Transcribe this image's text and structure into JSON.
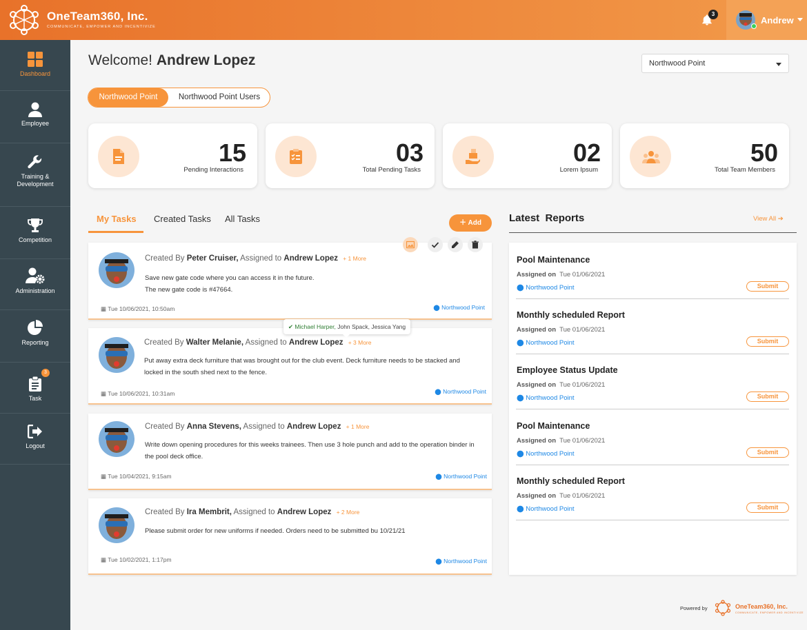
{
  "header": {
    "brand_name": "OneTeam360, Inc.",
    "brand_tagline": "COMMUNICATE, EMPOWER AND INCENTIVIZE",
    "notification_count": "3",
    "user_name": "Andrew",
    "colors": {
      "accent": "#f7943b",
      "sidebar": "#37474f",
      "link": "#1e88e5"
    }
  },
  "sidebar": {
    "items": [
      {
        "label": "Dashboard",
        "icon": "dashboard-grid-icon"
      },
      {
        "label": "Employee",
        "icon": "employee-icon"
      },
      {
        "label": "Training &\nDevelopment",
        "icon": "wrench-icon"
      },
      {
        "label": "Competition",
        "icon": "trophy-icon"
      },
      {
        "label": "Administration",
        "icon": "admin-gear-icon"
      },
      {
        "label": "Reporting",
        "icon": "pie-chart-icon"
      },
      {
        "label": "Task",
        "icon": "clipboard-icon",
        "badge": "3"
      },
      {
        "label": "Logout",
        "icon": "logout-icon"
      }
    ]
  },
  "main": {
    "welcome_prefix": "Welcome!",
    "welcome_name": "Andrew Lopez",
    "location_select": "Northwood Point",
    "segments": [
      "Northwood Point",
      "Northwood Point Users"
    ]
  },
  "stats": [
    {
      "value": "15",
      "label": "Pending Interactions",
      "icon": "document-icon"
    },
    {
      "value": "03",
      "label": "Total Pending Tasks",
      "icon": "clipboard-list-icon"
    },
    {
      "value": "02",
      "label": "Lorem Ipsum",
      "icon": "hand-boxes-icon"
    },
    {
      "value": "50",
      "label": "Total Team Members",
      "icon": "team-icon"
    }
  ],
  "tasks_panel": {
    "tabs": [
      "My Tasks",
      "Created Tasks",
      "All Tasks"
    ],
    "add_label": "Add",
    "tooltip_first": "Michael Harper,",
    "tooltip_rest": " John Spack, Jessica Yang",
    "tasks": [
      {
        "created_by_prefix": "Created By",
        "creator": "Peter Cruiser,",
        "assigned_prefix": "Assigned to",
        "assignee": "Andrew Lopez",
        "more": "1 More",
        "body": "Save new gate code where you can access it in the future.\nThe new gate code is #47664.",
        "date": "Tue 10/06/2021, 10:50am",
        "location": "Northwood Point"
      },
      {
        "created_by_prefix": "Created By",
        "creator": "Walter Melanie,",
        "assigned_prefix": "Assigned to",
        "assignee": "Andrew Lopez",
        "more": "3 More",
        "body": "Put away extra deck furniture that was brought out for the club event. Deck furniture needs to be stacked and locked in the south shed next to the fence.",
        "date": "Tue 10/06/2021, 10:31am",
        "location": "Northwood Point"
      },
      {
        "created_by_prefix": "Created By",
        "creator": "Anna Stevens,",
        "assigned_prefix": "Assigned to",
        "assignee": "Andrew Lopez",
        "more": "1 More",
        "body": "Write down opening procedures for this weeks trainees. Then use 3 hole punch and add to the operation binder in the pool deck office.",
        "date": "Tue 10/04/2021, 9:15am",
        "location": "Northwood Point"
      },
      {
        "created_by_prefix": "Created By",
        "creator": "Ira Membrit,",
        "assigned_prefix": "Assigned to",
        "assignee": "Andrew Lopez",
        "more": "2 More",
        "body": "Please submit order for new uniforms if needed. Orders need to be submitted bu 10/21/21",
        "date": "Tue 10/02/2021, 1:17pm",
        "location": "Northwood Point"
      }
    ]
  },
  "reports_panel": {
    "title": "Latest  Reports",
    "view_all": "View All",
    "reports": [
      {
        "title": "Pool Maintenance",
        "assigned_label": "Assigned on",
        "assigned_date": "Tue 01/06/2021",
        "location": "Northwood Point",
        "action": "Submit"
      },
      {
        "title": "Monthly scheduled Report",
        "assigned_label": "Assigned on",
        "assigned_date": "Tue 01/06/2021",
        "location": "Northwood Point",
        "action": "Submit"
      },
      {
        "title": "Employee Status Update",
        "assigned_label": "Assigned on",
        "assigned_date": "Tue 01/06/2021",
        "location": "Northwood Point",
        "action": "Submit"
      },
      {
        "title": "Pool Maintenance",
        "assigned_label": "Assigned on",
        "assigned_date": "Tue 01/06/2021",
        "location": "Northwood Point",
        "action": "Submit"
      },
      {
        "title": "Monthly scheduled Report",
        "assigned_label": "Assigned on",
        "assigned_date": "Tue 01/06/2021",
        "location": "Northwood Point",
        "action": "Submit"
      }
    ]
  },
  "footer": {
    "powered_by": "Powered by",
    "brand": "OneTeam360, Inc.",
    "tagline": "COMMUNICATE, EMPOWER AND INCENTIVIZE"
  }
}
